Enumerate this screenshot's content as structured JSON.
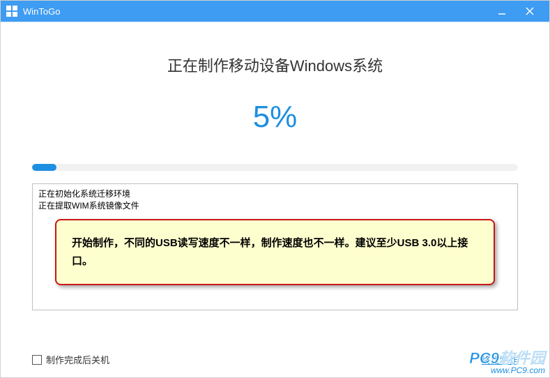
{
  "titlebar": {
    "title": "WinToGo"
  },
  "main": {
    "heading": "正在制作移动设备Windows系统",
    "percent_label": "5%",
    "percent_value": 5
  },
  "log": {
    "lines": [
      "正在初始化系统迁移环境",
      "正在提取WIM系统镜像文件"
    ]
  },
  "tip": {
    "text": "开始制作，不同的USB读写速度不一样，制作速度也不一样。建议至少USB 3.0以上接口。"
  },
  "footer": {
    "shutdown_label": "制作完成后关机",
    "shutdown_checked": false,
    "stop_label": "终止制作"
  },
  "watermark": {
    "line1": "PC9软件园",
    "line2": "www.PC9.com"
  }
}
